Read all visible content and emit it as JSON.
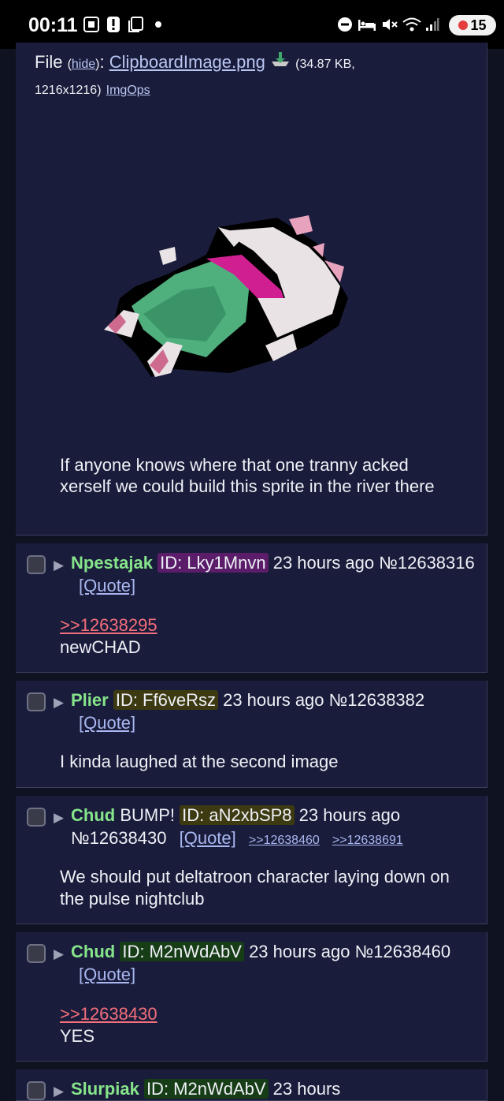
{
  "status_bar": {
    "time": "00:11",
    "notification_count": "15",
    "left_icons": [
      "screenshot-icon",
      "alert-icon",
      "copy-icon",
      "dot-icon"
    ],
    "right_icons": [
      "dnd-icon",
      "bed-icon",
      "mute-icon",
      "wifi-icon",
      "signal-icon"
    ]
  },
  "op": {
    "file_label": "File",
    "hide_label": "hide",
    "filename": "ClipboardImage.png",
    "file_info_size": "(34.87 KB,",
    "file_info_dims": "1216x1216)",
    "imgops": "ImgOps",
    "text": "If anyone knows where that one tranny acked xerself we could build this sprite in the river there"
  },
  "posts": [
    {
      "name": "Npestajak",
      "id": "ID: Lky1Mnvn",
      "time": "23 hours ago",
      "number": "№12638316",
      "quote": "[Quote]",
      "quotelink": ">>12638295",
      "text": "newCHAD"
    },
    {
      "name": "Plier",
      "id": "ID: Ff6veRsz",
      "time": "23 hours ago",
      "number": "№12638382",
      "quote": "[Quote]",
      "text": "I kinda laughed at the second image"
    },
    {
      "name": "Chud",
      "subject": "BUMP!",
      "id": "ID: aN2xbSP8",
      "time": "23 hours ago",
      "number": "№12638430",
      "quote": "[Quote]",
      "backlinks": [
        ">>12638460",
        ">>12638691"
      ],
      "text": "We should put deltatroon character laying down on the pulse nightclub"
    },
    {
      "name": "Chud",
      "id": "ID: M2nWdAbV",
      "time": "23 hours ago",
      "number": "№12638460",
      "quote": "[Quote]",
      "quotelink": ">>12638430",
      "text": "YES"
    },
    {
      "name": "Slurpiak",
      "id": "ID: M2nWdAbV",
      "time": "23 hours"
    }
  ],
  "colors": {
    "background": "#0f1221",
    "post_bg": "#1a1c3b",
    "name": "#86e58a",
    "quotelink": "#f36f7b",
    "link": "#a9b8f0",
    "id_purple": "#5b1d6a",
    "id_olive": "#3d3a12",
    "id_green": "#173d17"
  }
}
